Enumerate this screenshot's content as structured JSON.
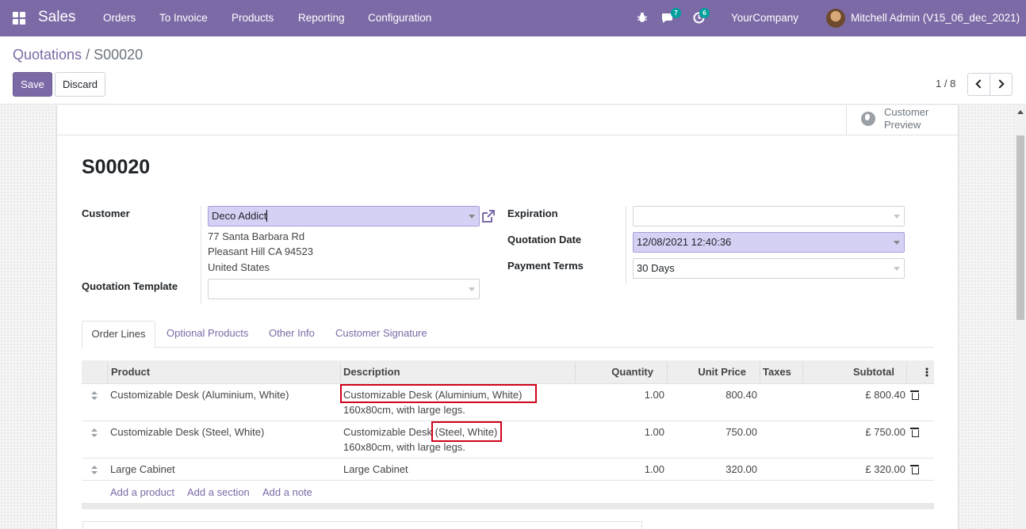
{
  "navbar": {
    "app_name": "Sales",
    "menu": [
      "Orders",
      "To Invoice",
      "Products",
      "Reporting",
      "Configuration"
    ],
    "messages_count": "7",
    "activities_count": "6",
    "company": "YourCompany",
    "user": "Mitchell Admin (V15_06_dec_2021)"
  },
  "breadcrumb": {
    "parent": "Quotations",
    "separator": "/",
    "current": "S00020"
  },
  "actions": {
    "save": "Save",
    "discard": "Discard"
  },
  "pager": {
    "value": "1 / 8"
  },
  "stat_button": {
    "line1": "Customer",
    "line2": "Preview"
  },
  "record": {
    "name": "S00020",
    "customer_label": "Customer",
    "customer_value": "Deco Addict",
    "address": [
      "77 Santa Barbara Rd",
      "Pleasant Hill CA 94523",
      "United States"
    ],
    "template_label": "Quotation Template",
    "template_value": "",
    "expiration_label": "Expiration",
    "expiration_value": "",
    "date_label": "Quotation Date",
    "date_value": "12/08/2021 12:40:36",
    "terms_label": "Payment Terms",
    "terms_value": "30 Days"
  },
  "tabs": [
    "Order Lines",
    "Optional Products",
    "Other Info",
    "Customer Signature"
  ],
  "table": {
    "columns": [
      "Product",
      "Description",
      "Quantity",
      "Unit Price",
      "Taxes",
      "Subtotal"
    ],
    "rows": [
      {
        "product": "Customizable Desk (Aluminium, White)",
        "desc1": "Customizable Desk (Aluminium, White)",
        "desc2": "160x80cm, with large legs.",
        "qty": "1.00",
        "price": "800.40",
        "taxes": "",
        "subtotal": "£ 800.40"
      },
      {
        "product": "Customizable Desk (Steel, White)",
        "desc1a": "Customizable Desk ",
        "desc1b": "(Steel, White)",
        "desc2": "160x80cm, with large legs.",
        "qty": "1.00",
        "price": "750.00",
        "taxes": "",
        "subtotal": "£ 750.00"
      },
      {
        "product": "Large Cabinet",
        "desc1": "Large Cabinet",
        "qty": "1.00",
        "price": "320.00",
        "taxes": "",
        "subtotal": "£ 320.00"
      }
    ],
    "add_links": [
      "Add a product",
      "Add a section",
      "Add a note"
    ]
  }
}
